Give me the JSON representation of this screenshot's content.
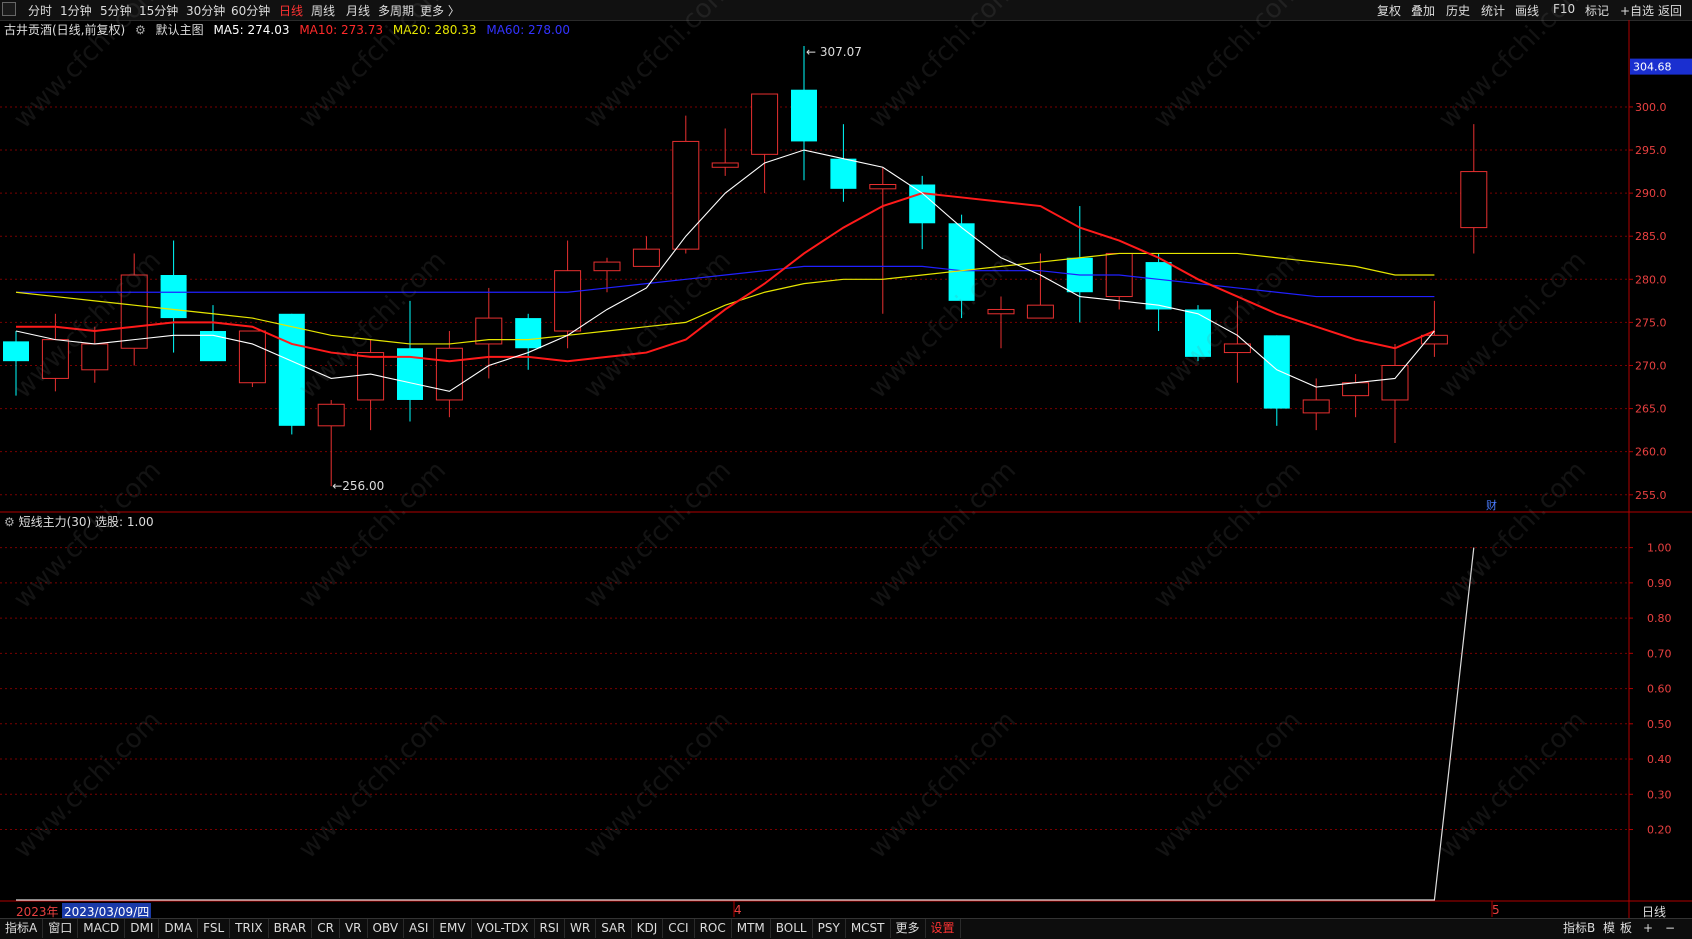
{
  "toolbar": {
    "periods": [
      "分时",
      "1分钟",
      "5分钟",
      "15分钟",
      "30分钟",
      "60分钟",
      "日线",
      "周线",
      "月线",
      "多周期",
      "更多 〉"
    ],
    "active_period": "日线",
    "right_tools": [
      "复权",
      "叠加",
      "历史",
      "统计",
      "画线",
      "F10",
      "标记",
      "+自选",
      "返回"
    ]
  },
  "info": {
    "stock": "古井贡酒(日线,前复权)",
    "main_chart_label": "默认主图",
    "ma5": "MA5: 274.03",
    "ma10": "MA10: 273.73",
    "ma20": "MA20: 280.33",
    "ma60": "MA60: 278.00"
  },
  "sub_info": "短线主力(30) 选股: 1.00",
  "price_axis": {
    "current_price": "304.68",
    "ticks": [
      "300.0",
      "295.0",
      "290.0",
      "285.0",
      "280.0",
      "275.0",
      "270.0",
      "265.0",
      "260.0",
      "255.0"
    ]
  },
  "sub_axis": {
    "ticks": [
      "1.00",
      "0.90",
      "0.80",
      "0.70",
      "0.60",
      "0.50",
      "0.40",
      "0.30",
      "0.20"
    ]
  },
  "markers": {
    "high": "307.07",
    "low": "256.00",
    "finance_icon": "财"
  },
  "dates": {
    "year": "2023年",
    "cursor_date": "2023/03/09/四",
    "month4": "4",
    "month5": "5",
    "period_label": "日线"
  },
  "indicator_tabs": [
    "指标A",
    "窗口",
    "MACD",
    "DMI",
    "DMA",
    "FSL",
    "TRIX",
    "BRAR",
    "CR",
    "VR",
    "OBV",
    "ASI",
    "EMV",
    "VOL-TDX",
    "RSI",
    "WR",
    "SAR",
    "KDJ",
    "CCI",
    "ROC",
    "MTM",
    "BOLL",
    "PSY",
    "MCST",
    "更多",
    "设置"
  ],
  "right_bottom_tabs": [
    "指标B",
    "模",
    "板",
    "+",
    "−"
  ],
  "watermark": "www.cfchi.com",
  "colors": {
    "up": "#e83030",
    "down": "#00ffff",
    "ma5": "#ffffff",
    "ma10": "#ff1a1a",
    "ma20": "#e6e600",
    "ma60": "#2020ff",
    "grid": "#7a0000"
  },
  "chart_data": {
    "type": "candlestick",
    "price_range": [
      253,
      308
    ],
    "candles": [
      {
        "o": 272.8,
        "h": 274.0,
        "l": 266.5,
        "c": 270.5
      },
      {
        "o": 268.5,
        "h": 276.0,
        "l": 267.0,
        "c": 273.0
      },
      {
        "o": 269.5,
        "h": 274.5,
        "l": 268.0,
        "c": 272.5
      },
      {
        "o": 272.0,
        "h": 283.0,
        "l": 270.0,
        "c": 280.5
      },
      {
        "o": 280.5,
        "h": 284.5,
        "l": 271.5,
        "c": 275.5
      },
      {
        "o": 274.0,
        "h": 277.0,
        "l": 270.5,
        "c": 270.5
      },
      {
        "o": 268.0,
        "h": 274.0,
        "l": 267.5,
        "c": 274.0
      },
      {
        "o": 276.0,
        "h": 276.0,
        "l": 262.0,
        "c": 263.0
      },
      {
        "o": 263.0,
        "h": 266.0,
        "l": 256.0,
        "c": 265.5
      },
      {
        "o": 266.0,
        "h": 273.0,
        "l": 262.5,
        "c": 271.5
      },
      {
        "o": 272.0,
        "h": 277.5,
        "l": 263.5,
        "c": 266.0
      },
      {
        "o": 266.0,
        "h": 274.0,
        "l": 264.0,
        "c": 272.0
      },
      {
        "o": 272.5,
        "h": 279.0,
        "l": 268.5,
        "c": 275.5
      },
      {
        "o": 275.5,
        "h": 276.0,
        "l": 269.5,
        "c": 272.0
      },
      {
        "o": 274.0,
        "h": 284.5,
        "l": 272.0,
        "c": 281.0
      },
      {
        "o": 281.0,
        "h": 282.5,
        "l": 278.5,
        "c": 282.0
      },
      {
        "o": 281.5,
        "h": 285.0,
        "l": 281.5,
        "c": 283.5
      },
      {
        "o": 283.5,
        "h": 299.0,
        "l": 283.0,
        "c": 296.0
      },
      {
        "o": 293.0,
        "h": 297.5,
        "l": 292.0,
        "c": 293.5
      },
      {
        "o": 294.5,
        "h": 300.5,
        "l": 290.0,
        "c": 301.5
      },
      {
        "o": 302.0,
        "h": 307.07,
        "l": 291.5,
        "c": 296.0
      },
      {
        "o": 294.0,
        "h": 298.0,
        "l": 289.0,
        "c": 290.5
      },
      {
        "o": 290.5,
        "h": 293.0,
        "l": 276.0,
        "c": 291.0
      },
      {
        "o": 291.0,
        "h": 292.0,
        "l": 283.5,
        "c": 286.5
      },
      {
        "o": 286.5,
        "h": 287.5,
        "l": 275.5,
        "c": 277.5
      },
      {
        "o": 276.0,
        "h": 278.0,
        "l": 272.0,
        "c": 276.5
      },
      {
        "o": 275.5,
        "h": 283.0,
        "l": 275.5,
        "c": 277.0
      },
      {
        "o": 282.5,
        "h": 288.5,
        "l": 275.0,
        "c": 278.5
      },
      {
        "o": 278.0,
        "h": 283.0,
        "l": 276.5,
        "c": 283.0
      },
      {
        "o": 282.0,
        "h": 283.0,
        "l": 274.0,
        "c": 276.5
      },
      {
        "o": 276.5,
        "h": 277.0,
        "l": 270.5,
        "c": 271.0
      },
      {
        "o": 271.5,
        "h": 277.5,
        "l": 268.0,
        "c": 272.5
      },
      {
        "o": 273.5,
        "h": 273.5,
        "l": 263.0,
        "c": 265.0
      },
      {
        "o": 264.5,
        "h": 268.5,
        "l": 262.5,
        "c": 266.0
      },
      {
        "o": 266.5,
        "h": 269.0,
        "l": 264.0,
        "c": 268.0
      },
      {
        "o": 266.0,
        "h": 272.5,
        "l": 261.0,
        "c": 270.0
      },
      {
        "o": 272.5,
        "h": 277.5,
        "l": 271.0,
        "c": 273.5
      },
      {
        "o": 286.0,
        "h": 298.0,
        "l": 283.0,
        "c": 292.5
      }
    ],
    "ma5": [
      274.0,
      273.0,
      272.5,
      273.0,
      273.5,
      273.5,
      272.5,
      270.5,
      268.5,
      269.0,
      268.0,
      267.0,
      270.0,
      271.5,
      273.5,
      276.5,
      279.0,
      285.0,
      290.0,
      293.5,
      295.0,
      294.0,
      293.0,
      290.0,
      286.0,
      282.5,
      280.5,
      278.0,
      277.5,
      277.0,
      276.0,
      273.5,
      269.5,
      267.5,
      268.0,
      268.5,
      274.0
    ],
    "ma10": [
      274.5,
      274.5,
      274.0,
      274.5,
      275.0,
      275.0,
      274.5,
      272.5,
      271.5,
      271.0,
      271.0,
      270.5,
      271.0,
      271.0,
      270.5,
      271.0,
      271.5,
      273.0,
      276.5,
      279.5,
      283.0,
      286.0,
      288.5,
      290.0,
      289.5,
      289.0,
      288.5,
      286.0,
      284.5,
      282.5,
      280.0,
      278.0,
      276.0,
      274.5,
      273.0,
      272.0,
      274.0
    ],
    "ma20": [
      278.5,
      278.0,
      277.5,
      277.0,
      276.5,
      276.0,
      275.5,
      274.5,
      273.5,
      273.0,
      272.5,
      272.5,
      273.0,
      273.0,
      273.5,
      274.0,
      274.5,
      275.0,
      277.0,
      278.5,
      279.5,
      280.0,
      280.0,
      280.5,
      281.0,
      281.5,
      282.0,
      282.5,
      283.0,
      283.0,
      283.0,
      283.0,
      282.5,
      282.0,
      281.5,
      280.5,
      280.5
    ],
    "ma60": [
      278.5,
      278.5,
      278.5,
      278.5,
      278.5,
      278.5,
      278.5,
      278.5,
      278.5,
      278.5,
      278.5,
      278.5,
      278.5,
      278.5,
      278.5,
      279.0,
      279.5,
      280.0,
      280.5,
      281.0,
      281.5,
      281.5,
      281.5,
      281.5,
      281.0,
      281.0,
      281.0,
      280.5,
      280.5,
      280.0,
      279.5,
      279.0,
      278.5,
      278.0,
      278.0,
      278.0,
      278.0
    ],
    "sub_indicator": {
      "name": "短线主力(30)",
      "range": [
        0,
        1.05
      ],
      "values": [
        0,
        0,
        0,
        0,
        0,
        0,
        0,
        0,
        0,
        0,
        0,
        0,
        0,
        0,
        0,
        0,
        0,
        0,
        0,
        0,
        0,
        0,
        0,
        0,
        0,
        0,
        0,
        0,
        0,
        0,
        0,
        0,
        0,
        0,
        0,
        0,
        0,
        1.0
      ]
    }
  }
}
